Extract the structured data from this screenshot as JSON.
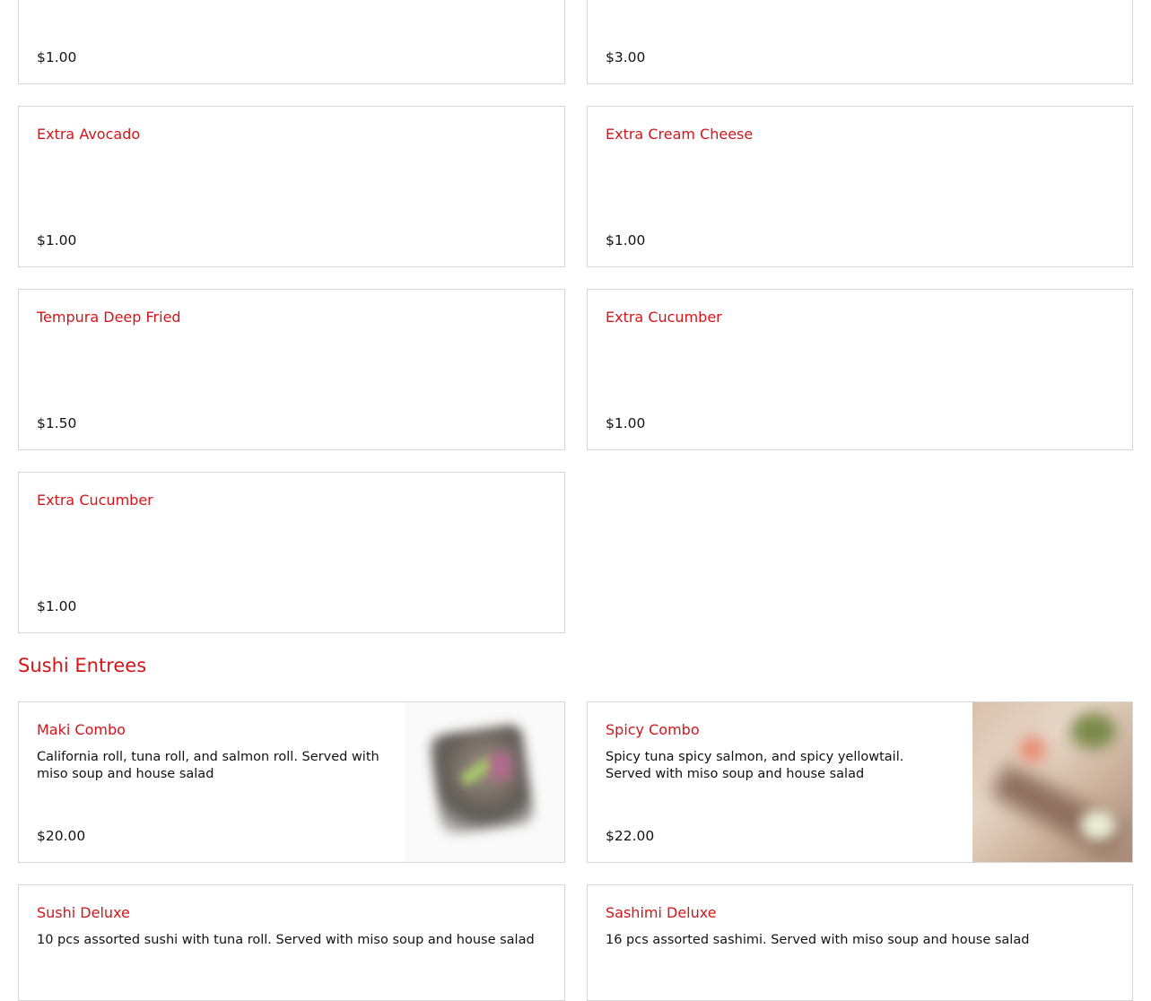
{
  "top_row": {
    "left_price": "$1.00",
    "right_price": "$3.00"
  },
  "addons": [
    {
      "name": "Extra Avocado",
      "price": "$1.00"
    },
    {
      "name": "Extra Cream Cheese",
      "price": "$1.00"
    },
    {
      "name": "Tempura Deep Fried",
      "price": "$1.50"
    },
    {
      "name": "Extra Cucumber",
      "price": "$1.00"
    },
    {
      "name": "Extra Cucumber",
      "price": "$1.00"
    }
  ],
  "section": {
    "title": "Sushi Entrees"
  },
  "entrees": [
    {
      "name": "Maki Combo",
      "description": "California roll, tuna roll, and salmon roll. Served with miso soup and house salad",
      "price": "$20.00"
    },
    {
      "name": "Spicy Combo",
      "description": "Spicy tuna spicy salmon, and spicy yellowtail. Served with miso soup and house salad",
      "price": "$22.00"
    },
    {
      "name": "Sushi Deluxe",
      "description": "10 pcs assorted sushi with tuna roll. Served with miso soup and house salad"
    },
    {
      "name": "Sashimi Deluxe",
      "description": "16 pcs assorted sashimi. Served with miso soup and house salad"
    }
  ],
  "colors": {
    "accent": "#d3151a",
    "border": "#d6d6d6",
    "text": "#111111"
  }
}
